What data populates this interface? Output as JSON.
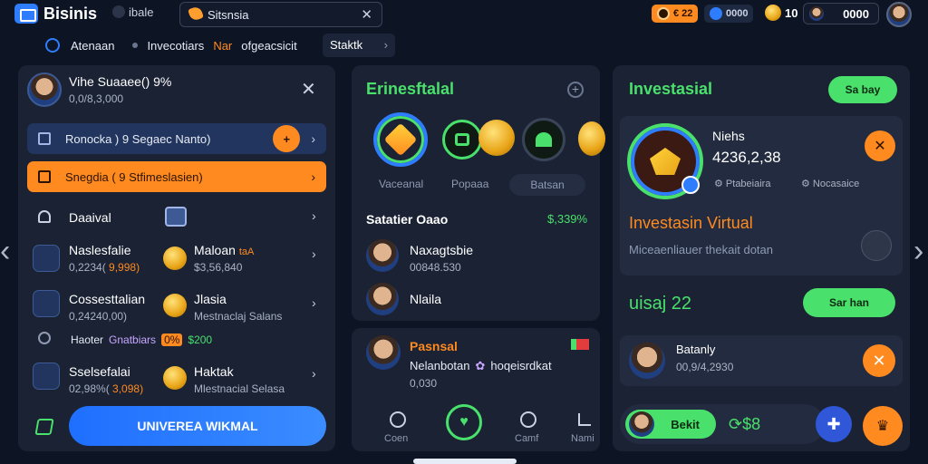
{
  "topbar": {
    "brand": "Bisinis",
    "view_label": "ibale",
    "search_value": "Sitsnsia",
    "balance_1": "€ 22",
    "balance_2": "0000",
    "coins": "10",
    "wallet": "0000"
  },
  "nav": {
    "items": [
      "Atenaan",
      "Invecotiars",
      "Nar",
      "ofgeacsicit"
    ],
    "stack_chip": "Staktk"
  },
  "left": {
    "profile_name": "Vihe Suaaee() 9%",
    "profile_value": "0,0/8,3,000",
    "row_blue": "Ronocka ) 9 Segaec Nanto)",
    "row_orange": "Snegdia ( 9 Stfimeslasien)",
    "section_title": "Daaival",
    "items": [
      {
        "title": "Naslesfalie",
        "sub": "0,2234(",
        "pct": "9,998)",
        "right_title": "Maloan",
        "right_badge": "taA",
        "right_sub": "$3,56,840"
      },
      {
        "title": "Cossesttalian",
        "sub": "0,24240,00)",
        "right_title": "Jlasia",
        "right_sub": "Mestnaclaj Salans"
      },
      {
        "title": "Sselsefalai",
        "sub": "02,98%(",
        "pct": "3,098)",
        "right_title": "Haktak",
        "right_sub": "Mlestnacial Selasa"
      }
    ],
    "inline_row": {
      "label": "Haoter",
      "tag": "Gnatbiars",
      "badge": "0%",
      "amount": "$200"
    },
    "cta": "UNIVEREA WIKMAL"
  },
  "mid": {
    "title": "Erinesftalal",
    "rings": [
      {
        "label": "Vaceanal"
      },
      {
        "label": "Popaaa"
      },
      {
        "label": "Batsan"
      }
    ],
    "subtitle": "Satatier Oaao",
    "subtitle_pct": "$,339%",
    "people": [
      {
        "name": "Naxagtsbie",
        "value": "00848.530"
      },
      {
        "name": "Nlaila",
        "value": ""
      }
    ]
  },
  "mid2": {
    "title": "Pasnsal",
    "line": "Nelanbotan",
    "line_tail": "hoqeisrdkat",
    "value": "0,030",
    "nav": [
      "Coen",
      "",
      "Camf",
      "Nami"
    ]
  },
  "right": {
    "title": "Investasial",
    "top_button": "Sa bay",
    "card_title": "Niehs",
    "card_value": "4236,2,38",
    "card_tag_1": "Ptabeiaira",
    "card_tag_2": "Nocasaice",
    "headline": "Investasin Virtual",
    "headline_sub": "Miceaenliauer thekait dotan",
    "amount": "uisaj 22",
    "amount_button": "Sar han",
    "person_name": "Batanly",
    "person_value": "00,9/4,2930",
    "bottom_chip": "Bekit",
    "bottom_value": "$8"
  },
  "colors": {
    "accent_orange": "#ff8a1f",
    "accent_green": "#49e06b",
    "accent_blue": "#2f7dff",
    "panel": "#1a2234",
    "bg": "#0d1424"
  }
}
